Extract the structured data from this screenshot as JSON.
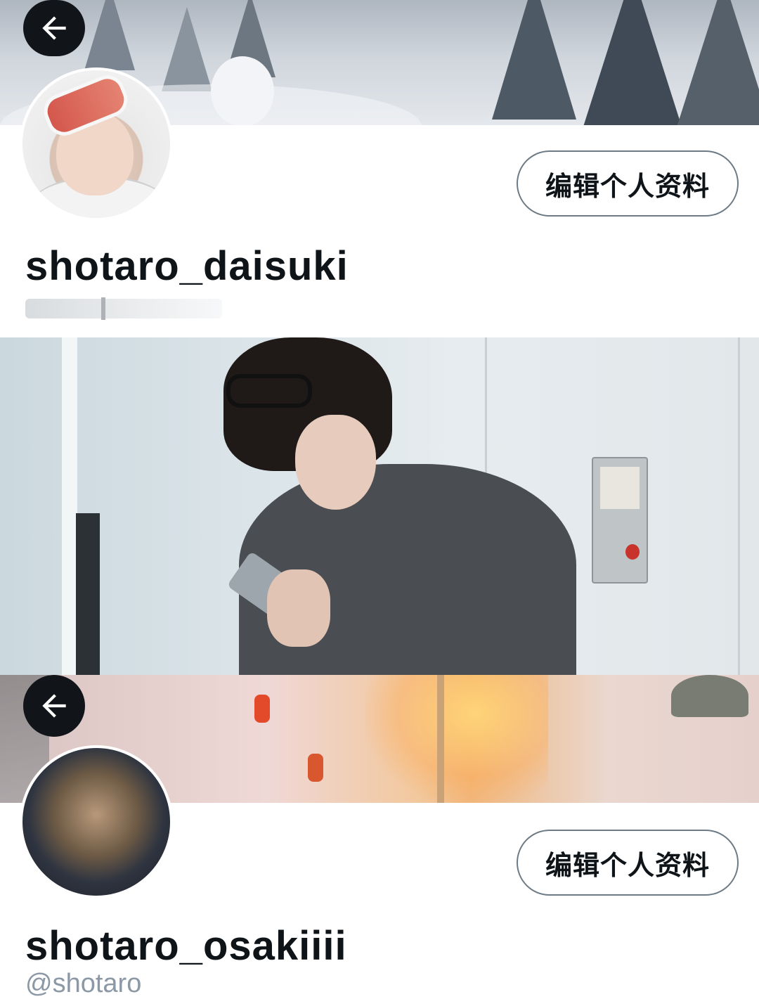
{
  "profiles": [
    {
      "username": "shotaro_daisuki",
      "handle": "",
      "edit_button_label": "编辑个人资料",
      "back_icon": "arrow-left-icon"
    },
    {
      "username": "shotaro_osakiiii",
      "handle": "@shotaro",
      "edit_button_label": "编辑个人资料",
      "back_icon": "arrow-left-icon"
    }
  ],
  "colors": {
    "text_primary": "#0f1419",
    "text_secondary": "#8b98a5",
    "button_border": "#6b7a85",
    "back_button_bg": "#111418"
  }
}
